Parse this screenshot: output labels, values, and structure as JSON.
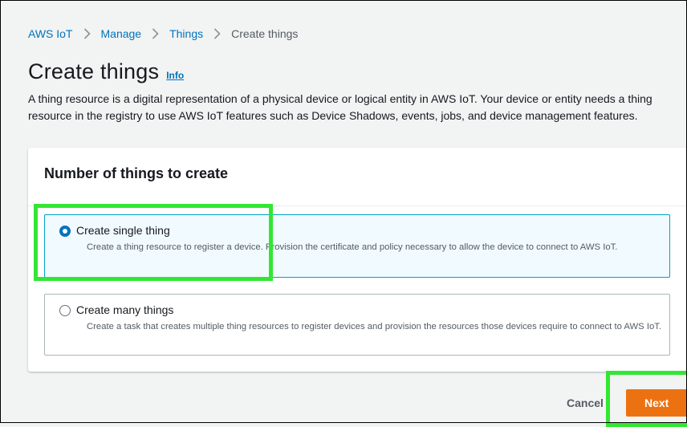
{
  "breadcrumb": {
    "items": [
      "AWS IoT",
      "Manage",
      "Things"
    ],
    "current": "Create things"
  },
  "page": {
    "title": "Create things",
    "info_link": "Info",
    "description": "A thing resource is a digital representation of a physical device or logical entity in AWS IoT. Your device or entity needs a thing resource in the registry to use AWS IoT features such as Device Shadows, events, jobs, and device management features."
  },
  "panel": {
    "header": "Number of things to create",
    "options": [
      {
        "label": "Create single thing",
        "description": "Create a thing resource to register a device. Provision the certificate and policy necessary to allow the device to connect to AWS IoT.",
        "selected": true
      },
      {
        "label": "Create many things",
        "description": "Create a task that creates multiple thing resources to register devices and provision the resources those devices require to connect to AWS IoT.",
        "selected": false
      }
    ]
  },
  "actions": {
    "cancel": "Cancel",
    "next": "Next"
  },
  "colors": {
    "link": "#0073bb",
    "primary_button": "#ec7211",
    "selected_border": "#00a1c9",
    "selected_bg": "#f1faff",
    "highlight": "#33e633"
  }
}
